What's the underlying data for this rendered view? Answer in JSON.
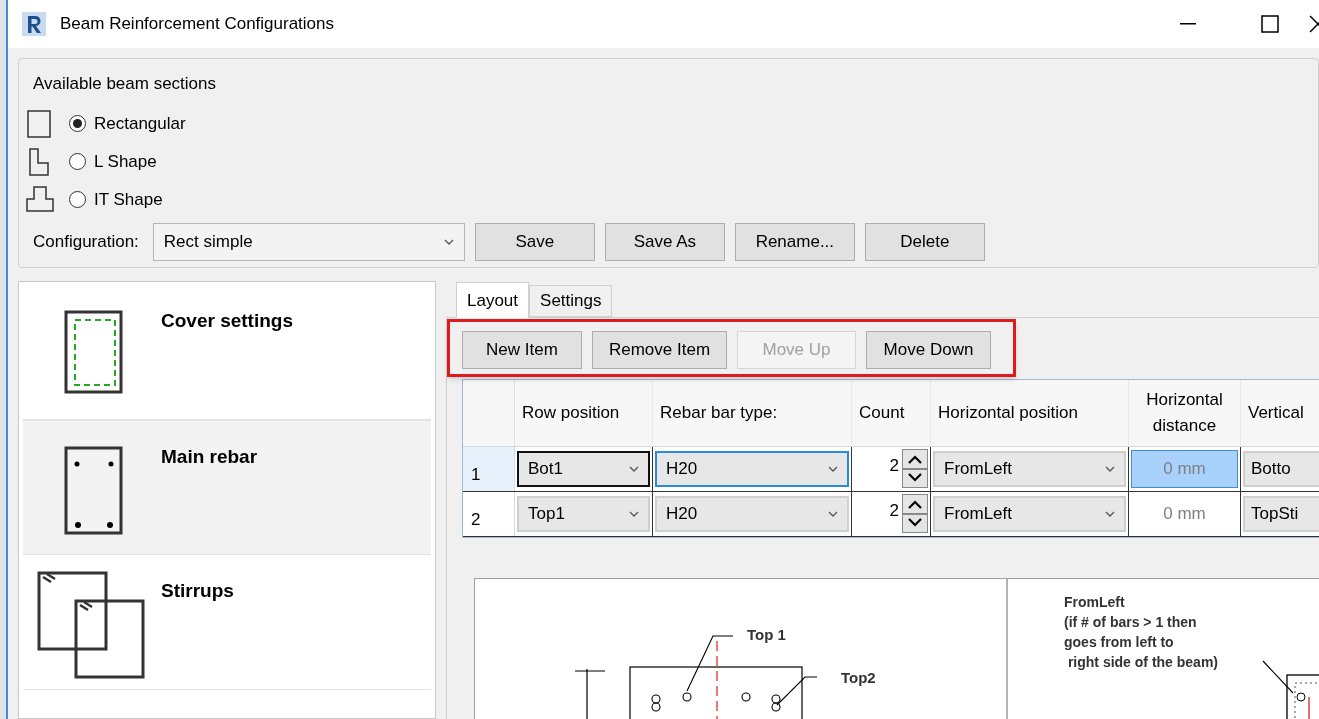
{
  "window": {
    "title": "Beam Reinforcement Configurations"
  },
  "sections": {
    "title": "Available beam sections",
    "options": [
      {
        "label": "Rectangular",
        "kind": "rect",
        "selected": true
      },
      {
        "label": "L Shape",
        "kind": "l_shape",
        "selected": false
      },
      {
        "label": "IT Shape",
        "kind": "t_shape",
        "selected": false
      }
    ]
  },
  "configuration": {
    "label": "Configuration:",
    "value": "Rect simple"
  },
  "config_buttons": [
    "Save",
    "Save As",
    "Rename...",
    "Delete"
  ],
  "categories": [
    {
      "label": "Cover settings",
      "kind": "cover",
      "selected": false
    },
    {
      "label": "Main rebar",
      "kind": "main",
      "selected": true
    },
    {
      "label": "Stirrups",
      "kind": "stirrups",
      "selected": false
    }
  ],
  "tabs": [
    {
      "label": "Layout",
      "selected": true
    },
    {
      "label": "Settings",
      "selected": false
    }
  ],
  "toolbar": [
    {
      "label": "New Item",
      "disabled": false
    },
    {
      "label": "Remove Item",
      "disabled": false
    },
    {
      "label": "Move Up",
      "disabled": true
    },
    {
      "label": "Move Down",
      "disabled": false
    }
  ],
  "grid": {
    "columns": [
      "Row position",
      "Rebar bar type:",
      "Count",
      "Horizontal position",
      "Horizontal distance",
      "Vertical"
    ],
    "rows": [
      {
        "number": "1",
        "row_position": "Bot1",
        "bar_type": "H20",
        "count": "2",
        "horizontal_position": "FromLeft",
        "horizontal_distance": "0 mm",
        "vertical": "Botto",
        "selected": true
      },
      {
        "number": "2",
        "row_position": "Top1",
        "bar_type": "H20",
        "count": "2",
        "horizontal_position": "FromLeft",
        "horizontal_distance": "0 mm",
        "vertical": "TopSti",
        "selected": false
      }
    ]
  },
  "diagram": {
    "labels": [
      "Top 1",
      "Top2"
    ],
    "note": "FromLeft\n(if # of bars > 1 then\ngoes from left to\n right side of the beam)"
  }
}
